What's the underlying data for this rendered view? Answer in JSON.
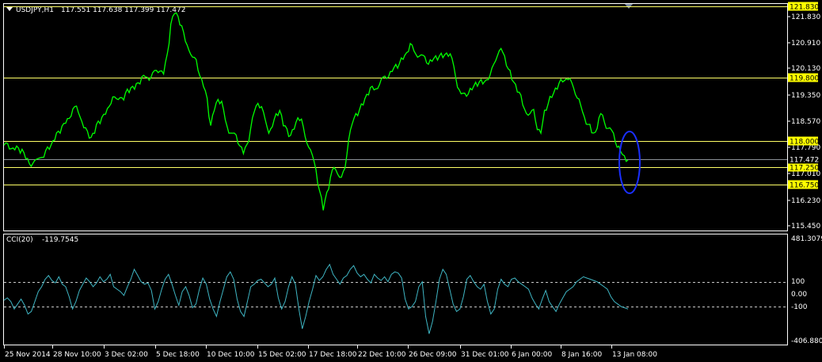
{
  "header": {
    "symbol_tf": "USDJPY,H1",
    "ohlc": "117.551 117.638 117.399 117.472"
  },
  "colors": {
    "background": "#000000",
    "price_line": "#00ff00",
    "cci_line": "#3fb6c4",
    "level_line": "#ffff66",
    "tag_bg": "#ffff00",
    "grid_frame": "#ffffff",
    "ellipse": "#1a2fff"
  },
  "chart_data": [
    {
      "type": "line",
      "name": "price-panel",
      "x_ticks": [
        "25 Nov 2014",
        "28 Nov 10:00",
        "3 Dec 02:00",
        "5 Dec 18:00",
        "10 Dec 10:00",
        "15 Dec 02:00",
        "17 Dec 18:00",
        "22 Dec 10:00",
        "26 Dec 09:00",
        "31 Dec 01:00",
        "6 Jan 00:00",
        "8 Jan 16:00",
        "13 Jan 08:00"
      ],
      "y_ticks": [
        "121.830",
        "120.910",
        "120.130",
        "119.350",
        "118.570",
        "117.790",
        "117.010",
        "116.230",
        "115.450"
      ],
      "ylim": [
        115.45,
        121.9
      ],
      "levels": [
        {
          "value": 121.83,
          "label": "121.830"
        },
        {
          "value": 119.8,
          "label": "119.800"
        },
        {
          "value": 118.0,
          "label": "118.000"
        },
        {
          "value": 117.25,
          "label": "117.250"
        },
        {
          "value": 116.75,
          "label": "116.750"
        }
      ],
      "current_price": {
        "value": 117.472,
        "label": "117.472"
      },
      "series": [
        {
          "values": [
            117.88,
            117.85,
            117.8,
            117.82,
            117.76,
            117.7,
            117.55,
            117.4,
            117.3,
            117.45,
            117.6,
            117.55,
            117.75,
            117.9,
            118.1,
            118.25,
            118.35,
            118.55,
            118.7,
            118.85,
            118.95,
            118.75,
            118.4,
            118.2,
            118.1,
            118.3,
            118.55,
            118.6,
            118.8,
            119.05,
            119.2,
            119.15,
            119.3,
            119.2,
            119.4,
            119.5,
            119.55,
            119.65,
            119.75,
            119.85,
            119.8,
            119.9,
            119.95,
            120.05,
            119.95,
            120.4,
            121.3,
            121.7,
            121.55,
            121.2,
            120.85,
            120.65,
            120.35,
            120.25,
            119.9,
            119.6,
            119.15,
            118.4,
            118.95,
            119.2,
            119.05,
            118.6,
            118.3,
            118.2,
            118.1,
            117.9,
            117.7,
            117.85,
            118.3,
            118.9,
            119.1,
            118.9,
            118.6,
            118.3,
            118.4,
            118.7,
            118.9,
            118.5,
            118.3,
            118.1,
            118.4,
            118.7,
            118.55,
            118.1,
            117.9,
            117.6,
            117.1,
            116.6,
            116.1,
            116.5,
            116.9,
            117.3,
            117.1,
            116.9,
            117.2,
            118.1,
            118.5,
            118.7,
            118.9,
            119.1,
            119.3,
            119.45,
            119.5,
            119.55,
            119.7,
            119.8,
            119.9,
            120.0,
            120.1,
            120.2,
            120.4,
            120.5,
            120.7,
            120.6,
            120.45,
            120.4,
            120.35,
            120.25,
            120.3,
            120.35,
            120.4,
            120.45,
            120.5,
            120.4,
            120.15,
            119.6,
            119.3,
            119.3,
            119.4,
            119.5,
            119.6,
            119.65,
            119.7,
            119.75,
            119.8,
            120.2,
            120.5,
            120.6,
            120.35,
            120.1,
            119.8,
            119.55,
            119.35,
            119.1,
            118.8,
            118.7,
            118.9,
            118.4,
            118.2,
            118.8,
            119.1,
            119.3,
            119.45,
            119.6,
            119.75,
            119.8,
            119.7,
            119.5,
            119.3,
            119.0,
            118.6,
            118.5,
            118.3,
            118.2,
            118.6,
            118.8,
            118.4,
            118.3,
            118.2,
            117.9,
            117.7,
            117.5,
            117.47
          ]
        }
      ]
    },
    {
      "type": "line",
      "name": "cci-panel",
      "indicator": "CCI(20)",
      "indicator_value": "-119.7545",
      "y_ticks": [
        "481.3079",
        "100",
        "0.00",
        "-100",
        "-406.8805"
      ],
      "ylim": [
        -406.8805,
        481.3079
      ],
      "levels": [
        100,
        -100
      ],
      "series": [
        {
          "values": [
            -50,
            -30,
            -60,
            -120,
            -80,
            -40,
            -90,
            -160,
            -140,
            -60,
            20,
            60,
            120,
            150,
            110,
            90,
            140,
            80,
            60,
            -20,
            -120,
            -60,
            30,
            80,
            130,
            100,
            60,
            90,
            140,
            100,
            120,
            160,
            60,
            40,
            20,
            -10,
            60,
            120,
            200,
            150,
            100,
            80,
            90,
            30,
            -120,
            -60,
            40,
            120,
            160,
            80,
            -10,
            -90,
            20,
            60,
            -10,
            -110,
            -80,
            40,
            130,
            80,
            -40,
            -120,
            -180,
            -60,
            40,
            140,
            180,
            120,
            -40,
            -140,
            -180,
            -60,
            60,
            80,
            110,
            120,
            90,
            60,
            80,
            130,
            -30,
            -120,
            -60,
            60,
            140,
            80,
            -120,
            -280,
            -180,
            -60,
            40,
            150,
            110,
            140,
            200,
            240,
            160,
            120,
            80,
            130,
            150,
            200,
            230,
            170,
            140,
            160,
            120,
            90,
            160,
            130,
            110,
            140,
            100,
            160,
            180,
            170,
            130,
            -40,
            -120,
            -100,
            -60,
            60,
            100,
            -180,
            -320,
            -220,
            -60,
            120,
            200,
            160,
            40,
            -80,
            -140,
            -120,
            -20,
            120,
            150,
            100,
            60,
            40,
            80,
            -60,
            -160,
            -120,
            40,
            120,
            80,
            60,
            120,
            130,
            100,
            80,
            60,
            40,
            -30,
            -80,
            -120,
            -40,
            30,
            -60,
            -100,
            -140,
            -80,
            -30,
            20,
            40,
            60,
            100,
            120,
            140,
            130,
            120,
            110,
            100,
            80,
            60,
            40,
            -20,
            -60,
            -80,
            -100,
            -110,
            -120
          ]
        }
      ]
    }
  ]
}
